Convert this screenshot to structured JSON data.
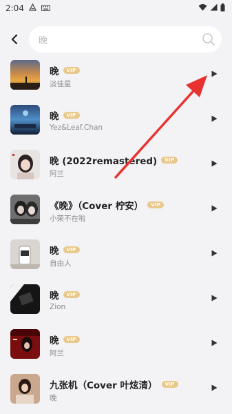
{
  "status": {
    "time": "2:04",
    "icons": [
      "a-notify-icon",
      "keyboard-icon",
      "wifi-icon",
      "signal-icon",
      "battery-icon"
    ]
  },
  "search": {
    "back_icon": "back-arrow-icon",
    "query": "晚",
    "search_icon": "search-icon"
  },
  "songs": [
    {
      "title": "晚",
      "badge": "VIP",
      "artist": "淡佳星",
      "play_icon": "play-icon"
    },
    {
      "title": "晚",
      "badge": "VIP",
      "artist": "Yez&Leaf.Chan",
      "play_icon": "play-icon"
    },
    {
      "title": "晚 (2022remastered)",
      "badge": "VIP",
      "artist": "阿兰",
      "play_icon": "play-icon"
    },
    {
      "title": "《晚》（Cover 柠安）",
      "badge": "VIP",
      "artist": "小荣不在啦",
      "play_icon": "play-icon"
    },
    {
      "title": "晚",
      "badge": "VIP",
      "artist": "自由人",
      "play_icon": "play-icon"
    },
    {
      "title": "晚",
      "badge": "VIP",
      "artist": "Zion",
      "play_icon": "play-icon"
    },
    {
      "title": "晚",
      "badge": "VIP",
      "artist": "阿兰",
      "play_icon": "play-icon"
    },
    {
      "title": "九张机（Cover 叶炫清）",
      "badge": "VIP",
      "artist": "晚",
      "play_icon": "play-icon"
    }
  ],
  "colors": {
    "background": "#f3f3f6",
    "vip_badge": "#e9c98b",
    "annotation_arrow": "#e8322f"
  }
}
